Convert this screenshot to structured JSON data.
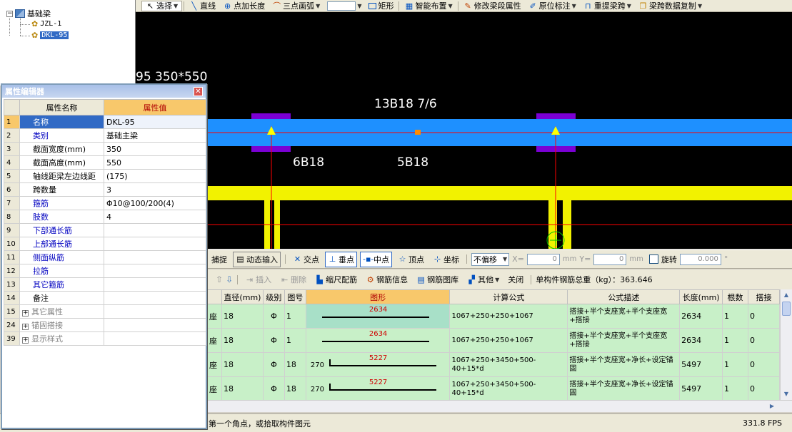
{
  "tree": {
    "root_label": "基础梁",
    "children": [
      "JZL-1",
      "DKL-95"
    ],
    "selected": "DKL-95"
  },
  "toolbar": {
    "select": "选择",
    "line": "直线",
    "point_add_length": "点加长度",
    "three_point_arc": "三点画弧",
    "rectangle": "矩形",
    "smart_layout": "智能布置",
    "modify_span_props": "修改梁段属性",
    "original_annotation": "原位标注",
    "repick_span": "重提梁跨",
    "span_data_copy": "梁跨数据复制"
  },
  "canvas": {
    "beam_label": "95 350*550",
    "top_rebar": "13B18 7/6",
    "bottom_left_rebar": "6B18",
    "bottom_mid_rebar": "5B18",
    "colors": {
      "beam": "#1e90ff",
      "support": "#7b00d4",
      "foundation": "#f2f200",
      "axis": "#ff0000",
      "ground_line": "#ff0000"
    }
  },
  "snap_bar": {
    "capture": "捕捉",
    "dynamic_input": "动态输入",
    "intersection": "交点",
    "perpendicular": "垂点",
    "midpoint": "中点",
    "vertex": "顶点",
    "coordinate": "坐标",
    "offset_mode": "不偏移",
    "x_label": "X=",
    "x_value": "0",
    "x_unit": "mm",
    "y_label": "Y=",
    "y_value": "0",
    "y_unit": "mm",
    "rotate": "旋转",
    "rotate_value": "0.000",
    "degree": "°"
  },
  "rebar_bar": {
    "insert": "插入",
    "delete": "删除",
    "scale_rebar": "缩尺配筋",
    "rebar_info": "钢筋信息",
    "rebar_library": "钢筋图库",
    "other": "其他",
    "close": "关闭",
    "total_weight_label": "单构件钢筋总重（kg）：",
    "total_weight": "363.646"
  },
  "rebar_table": {
    "headers": [
      "直径(mm)",
      "级别",
      "图号",
      "图形",
      "计算公式",
      "公式描述",
      "长度(mm)",
      "根数",
      "搭接"
    ],
    "rows": [
      {
        "prefix": "座",
        "dia": "18",
        "grade": "Φ",
        "fig_no": "1",
        "fig_left": "",
        "fig_value": "2634",
        "formula": "1067+250+250+1067",
        "desc": "搭接+半个支座宽+半个支座宽+搭接",
        "length": "2634",
        "count": "1",
        "lap": "0"
      },
      {
        "prefix": "座",
        "dia": "18",
        "grade": "Φ",
        "fig_no": "1",
        "fig_left": "",
        "fig_value": "2634",
        "formula": "1067+250+250+1067",
        "desc": "搭接+半个支座宽+半个支座宽+搭接",
        "length": "2634",
        "count": "1",
        "lap": "0"
      },
      {
        "prefix": "座",
        "dia": "18",
        "grade": "Φ",
        "fig_no": "18",
        "fig_left": "270",
        "fig_value": "5227",
        "formula": "1067+250+3450+500-40+15*d",
        "desc": "搭接+半个支座宽+净长+设定锚固",
        "length": "5497",
        "count": "1",
        "lap": "0"
      },
      {
        "prefix": "座",
        "dia": "18",
        "grade": "Φ",
        "fig_no": "18",
        "fig_left": "270",
        "fig_value": "5227",
        "formula": "1067+250+3450+500-40+15*d",
        "desc": "搭接+半个支座宽+净长+设定锚固",
        "length": "5497",
        "count": "1",
        "lap": "0"
      }
    ]
  },
  "status": {
    "prompt": "第一个角点，或拾取构件图元",
    "fps": "331.8 FPS"
  },
  "prop_editor": {
    "title": "属性编辑器",
    "col_name": "属性名称",
    "col_value": "属性值",
    "rows": [
      {
        "no": "1",
        "name": "名称",
        "value": "DKL-95",
        "style": "selected"
      },
      {
        "no": "2",
        "name": "类别",
        "value": "基础主梁",
        "style": "blue"
      },
      {
        "no": "3",
        "name": "截面宽度(mm)",
        "value": "350",
        "style": "black"
      },
      {
        "no": "4",
        "name": "截面高度(mm)",
        "value": "550",
        "style": "black"
      },
      {
        "no": "5",
        "name": "轴线距梁左边线距",
        "value": "(175)",
        "style": "black"
      },
      {
        "no": "6",
        "name": "跨数量",
        "value": "3",
        "style": "black"
      },
      {
        "no": "7",
        "name": "箍筋",
        "value": "Φ10@100/200(4)",
        "style": "blue"
      },
      {
        "no": "8",
        "name": "肢数",
        "value": "4",
        "style": "blue"
      },
      {
        "no": "9",
        "name": "下部通长筋",
        "value": "",
        "style": "blue"
      },
      {
        "no": "10",
        "name": "上部通长筋",
        "value": "",
        "style": "blue"
      },
      {
        "no": "11",
        "name": "侧面纵筋",
        "value": "",
        "style": "blue"
      },
      {
        "no": "12",
        "name": "拉筋",
        "value": "",
        "style": "blue"
      },
      {
        "no": "13",
        "name": "其它箍筋",
        "value": "",
        "style": "blue"
      },
      {
        "no": "14",
        "name": "备注",
        "value": "",
        "style": "black"
      },
      {
        "no": "15",
        "name": "其它属性",
        "value": "",
        "style": "group"
      },
      {
        "no": "24",
        "name": "锚固搭接",
        "value": "",
        "style": "group"
      },
      {
        "no": "39",
        "name": "显示样式",
        "value": "",
        "style": "group"
      }
    ]
  }
}
